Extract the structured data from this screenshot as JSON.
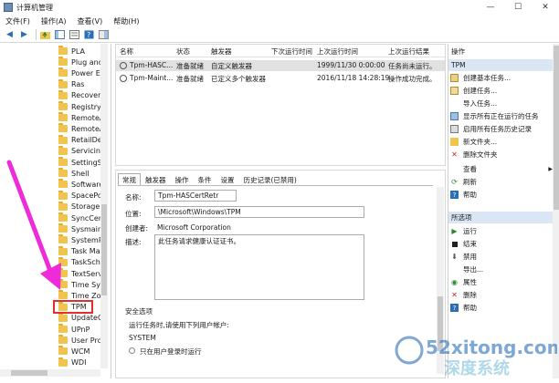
{
  "window": {
    "title": "计算机管理",
    "controls": [
      "—",
      "☐",
      "✕"
    ]
  },
  "menu": [
    "文件(F)",
    "操作(A)",
    "查看(V)",
    "帮助(H)"
  ],
  "tree": {
    "items": [
      "PLA",
      "Plug and",
      "Power Ef",
      "Ras",
      "Recovery",
      "Registry",
      "RemoteA",
      "RemoteA",
      "RetailDer",
      "Servicing",
      "SettingSy",
      "Shell",
      "Software",
      "SpacePo",
      "Storage",
      "SyncCent",
      "Sysmain",
      "SystemRe",
      "Task Ma",
      "TaskSche",
      "TextServi",
      "Time Syn",
      "Time Zor",
      "TPM",
      "UpdateC",
      "UPnP",
      "User Pro",
      "WCM",
      "WDI"
    ],
    "selected": "TPM"
  },
  "list": {
    "columns": [
      "名称",
      "状态",
      "触发器",
      "下次运行时间",
      "上次运行时间",
      "上次运行结果"
    ],
    "rows": [
      [
        "Tpm-HASC...",
        "准备就绪",
        "自定义触发器",
        "",
        "1999/11/30 0:00:00",
        "任务尚未运行。"
      ],
      [
        "Tpm-Maint...",
        "准备就绪",
        "已定义多个触发器",
        "",
        "2016/11/18 14:28:19",
        "操作成功完成。"
      ]
    ]
  },
  "detail": {
    "tabs": [
      "常规",
      "触发器",
      "操作",
      "条件",
      "设置",
      "历史记录(已禁用)"
    ],
    "name_label": "名称:",
    "name": "Tpm-HASCertRetr",
    "location_label": "位置:",
    "location": "\\Microsoft\\Windows\\TPM",
    "author_label": "创建者:",
    "author": "Microsoft Corporation",
    "desc_label": "描述:",
    "desc": "此任务请求健康认证证书。",
    "security_title": "安全选项",
    "run_as_label": "运行任务时,请使用下列用户帐户:",
    "run_as": "SYSTEM",
    "opt1": "只在用户登录时运行"
  },
  "actions": {
    "header": "操作",
    "group1": "TPM",
    "items1": [
      "创建基本任务...",
      "创建任务...",
      "导入任务...",
      "显示所有正在运行的任务",
      "启用所有任务历史记录",
      "新文件夹...",
      "删除文件夹",
      "查看",
      "刷新",
      "帮助"
    ],
    "group2": "所选项",
    "items2": [
      "运行",
      "结束",
      "禁用",
      "导出...",
      "属性",
      "删除",
      "帮助"
    ]
  },
  "watermark": {
    "text": "52xitong.com",
    "brand": "深度系统"
  }
}
